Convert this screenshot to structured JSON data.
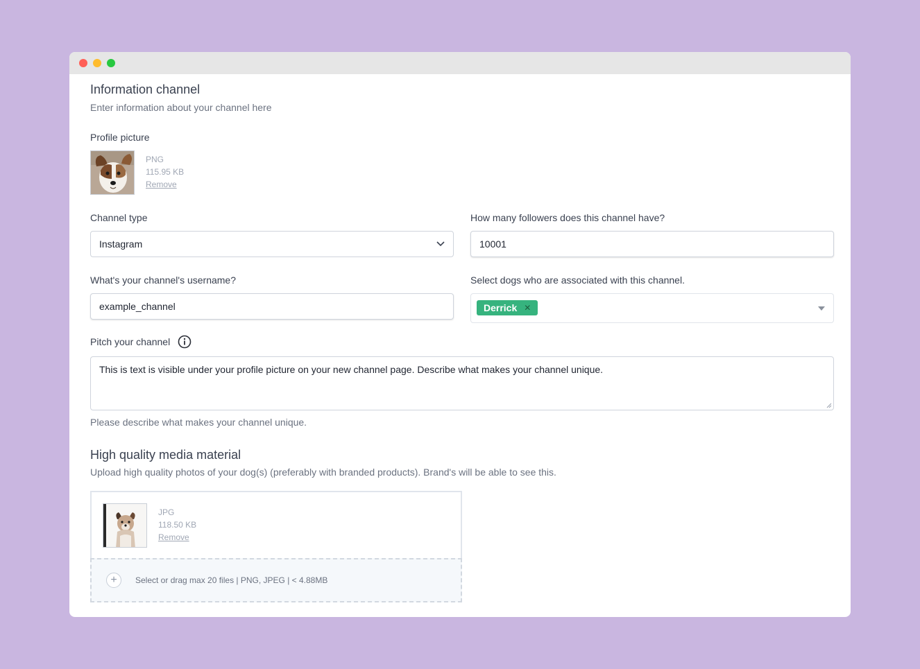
{
  "section1": {
    "title": "Information channel",
    "subtitle": "Enter information about your channel here"
  },
  "profile_picture": {
    "label": "Profile picture",
    "file_type": "PNG",
    "file_size": "115.95 KB",
    "remove_label": "Remove"
  },
  "channel_type": {
    "label": "Channel type",
    "value": "Instagram"
  },
  "followers": {
    "label": "How many followers does this channel have?",
    "value": "10001"
  },
  "username": {
    "label": "What's your channel's username?",
    "value": "example_channel"
  },
  "dogs": {
    "label": "Select dogs who are associated with this channel.",
    "selected": [
      "Derrick"
    ]
  },
  "pitch": {
    "label": "Pitch your channel",
    "value": "This is text is visible under your profile picture on your new channel page. Describe what makes your channel unique.",
    "helper": "Please describe what makes your channel unique."
  },
  "section2": {
    "title": "High quality media material",
    "subtitle": "Upload high quality photos of your dog(s) (preferably with branded products). Brand's will be able to see this."
  },
  "media_file": {
    "file_type": "JPG",
    "file_size": "118.50 KB",
    "remove_label": "Remove"
  },
  "dropzone": {
    "text": "Select or drag max 20 files | PNG, JPEG | < 4.88MB"
  },
  "colors": {
    "background": "#c9b6e0",
    "tag_green": "#36b37e",
    "close": "#ff5f57",
    "minimize": "#febc2e",
    "zoom": "#28c840"
  },
  "icons": [
    "close-dot",
    "minimize-dot",
    "zoom-dot",
    "chevron-down-icon",
    "caret-down-icon",
    "info-icon",
    "resize-handle-icon",
    "plus-icon",
    "tag-remove-icon"
  ]
}
